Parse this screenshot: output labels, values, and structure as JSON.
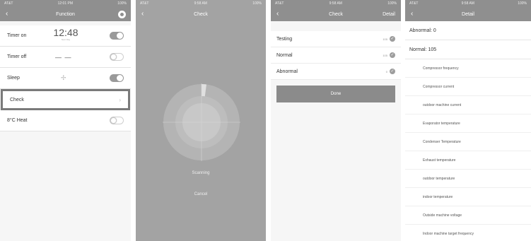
{
  "screen1": {
    "status": {
      "carrier": "AT&T",
      "time": "12:01 PM",
      "battery": "100%"
    },
    "title": "Function",
    "rows": [
      {
        "label": "Timer on",
        "value": "12:48",
        "sub": "Next Day"
      },
      {
        "label": "Timer off",
        "value": "— —"
      },
      {
        "label": "Sleep"
      },
      {
        "label": "Check"
      },
      {
        "label": "8°C Heat"
      }
    ]
  },
  "screen2": {
    "status": {
      "carrier": "AT&T",
      "time": "9:58 AM",
      "battery": "100%"
    },
    "title": "Check",
    "scanning": "Scanning",
    "cancel": "Cancel"
  },
  "screen3": {
    "status": {
      "carrier": "AT&T",
      "time": "9:58 AM",
      "battery": "100%"
    },
    "title": "Check",
    "detail": "Detail",
    "items": [
      {
        "label": "Testing",
        "count": "105"
      },
      {
        "label": "Normal",
        "count": "105"
      },
      {
        "label": "Abnormal",
        "count": "0"
      }
    ],
    "done": "Done"
  },
  "screen4": {
    "status": {
      "carrier": "AT&T",
      "time": "9:58 AM",
      "battery": "100%"
    },
    "title": "Detail",
    "abnormal": "Abnormal: 0",
    "normal": "Normal: 105",
    "items": [
      "Compressor frequency",
      "Compressor current",
      "outdoor machine current",
      "Evaporator temperature",
      "Condenser Temperature",
      "Exhaust temperature",
      "outdoor temperature",
      "indoor temperature",
      "Outside machine voltage",
      "Indoor machine target frequency"
    ]
  }
}
